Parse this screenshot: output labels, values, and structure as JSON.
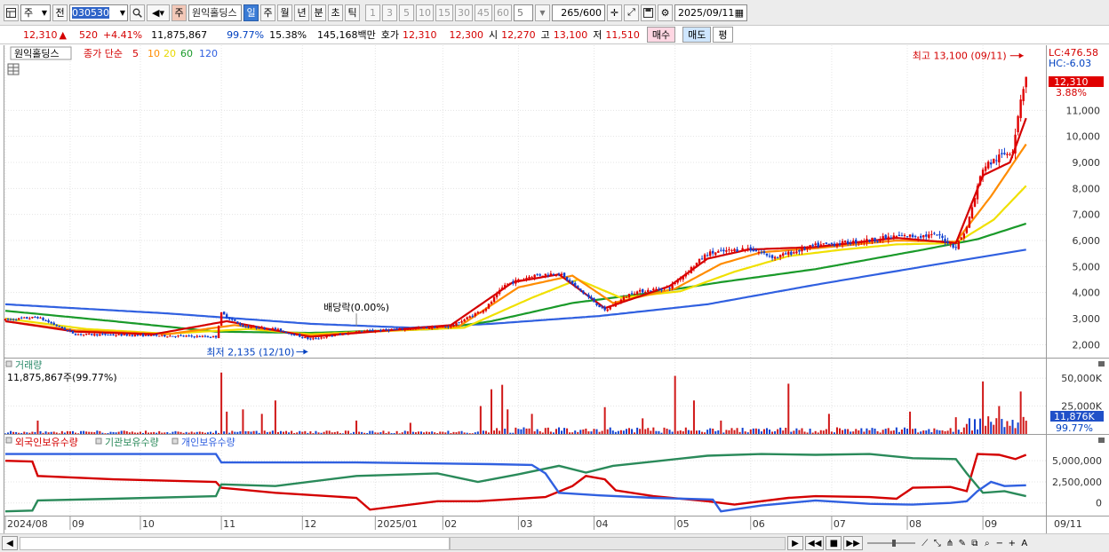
{
  "toolbar": {
    "icon_left": "chart-layout-icon",
    "market_combo": "주",
    "prev_label": "전",
    "stock_code": "030530",
    "stock_name": "원익홀딩스",
    "stock_tag": "주",
    "periods": [
      "일",
      "주",
      "월",
      "년",
      "분",
      "초",
      "틱"
    ],
    "selected_period": "일",
    "intervals": [
      "1",
      "3",
      "5",
      "10",
      "15",
      "30",
      "45",
      "60"
    ],
    "interval_value": "5",
    "count_current": "265",
    "count_total": "/600",
    "date": "2025/09/11"
  },
  "quote": {
    "price": "12,310",
    "change_arrow": "▲",
    "change": "520",
    "change_pct": "+4.41%",
    "volume": "11,875,867",
    "volume_ratio": "99.77%",
    "turnover": "15.38%",
    "amount": "145,168백만",
    "ask_label": "호가",
    "ask": "12,310",
    "bid": "12,300",
    "open_label": "시",
    "open": "12,270",
    "high_label": "고",
    "high": "13,100",
    "low_label": "저",
    "low": "11,510",
    "buy_label": "매수",
    "sell_label": "매도",
    "eval_label": "평"
  },
  "chart_data": [
    {
      "type": "candlestick",
      "title": "원익홀딩스",
      "legend": [
        "종가 단순",
        "5",
        "10",
        "20",
        "60",
        "120"
      ],
      "legend_colors": [
        "#d40000",
        "#d40000",
        "#ff8c00",
        "#e8d800",
        "#1a9a2a",
        "#3060e0"
      ],
      "y_ticks": [
        2000,
        3000,
        4000,
        5000,
        6000,
        7000,
        8000,
        9000,
        10000,
        11000
      ],
      "y_tick_labels": [
        "2,000",
        "3,000",
        "4,000",
        "5,000",
        "6,000",
        "7,000",
        "8,000",
        "9,000",
        "10,000",
        "11,000"
      ],
      "ylim": [
        1500,
        13500
      ],
      "x_labels": [
        "2024/08",
        "09",
        "10",
        "11",
        "12",
        "2025/01",
        "02",
        "03",
        "04",
        "05",
        "06",
        "07",
        "08",
        "09"
      ],
      "x_label_positions": [
        0,
        24,
        50,
        80,
        110,
        137,
        162,
        190,
        218,
        248,
        276,
        306,
        334,
        362
      ],
      "n_days": 385,
      "price_path": [
        [
          0,
          2950
        ],
        [
          12,
          3050
        ],
        [
          26,
          2400
        ],
        [
          55,
          2350
        ],
        [
          78,
          2300
        ],
        [
          80,
          3200
        ],
        [
          88,
          2700
        ],
        [
          100,
          2600
        ],
        [
          113,
          2200
        ],
        [
          130,
          2500
        ],
        [
          140,
          2550
        ],
        [
          165,
          2700
        ],
        [
          178,
          3400
        ],
        [
          185,
          4300
        ],
        [
          195,
          4650
        ],
        [
          205,
          4750
        ],
        [
          215,
          3900
        ],
        [
          222,
          3300
        ],
        [
          232,
          4000
        ],
        [
          246,
          4200
        ],
        [
          260,
          5500
        ],
        [
          275,
          5700
        ],
        [
          285,
          5350
        ],
        [
          300,
          5800
        ],
        [
          315,
          5950
        ],
        [
          330,
          6150
        ],
        [
          345,
          6200
        ],
        [
          352,
          5750
        ],
        [
          356,
          6500
        ],
        [
          362,
          8800
        ],
        [
          368,
          9200
        ],
        [
          373,
          9500
        ],
        [
          376,
          11500
        ],
        [
          378,
          12310
        ]
      ],
      "ma_paths": {
        "5": [
          [
            0,
            2900
          ],
          [
            26,
            2500
          ],
          [
            55,
            2400
          ],
          [
            82,
            2900
          ],
          [
            113,
            2300
          ],
          [
            165,
            2750
          ],
          [
            188,
            4400
          ],
          [
            205,
            4700
          ],
          [
            222,
            3400
          ],
          [
            246,
            4250
          ],
          [
            260,
            5300
          ],
          [
            275,
            5650
          ],
          [
            300,
            5750
          ],
          [
            330,
            6100
          ],
          [
            352,
            5900
          ],
          [
            362,
            8500
          ],
          [
            372,
            9000
          ],
          [
            378,
            10700
          ]
        ],
        "10": [
          [
            0,
            2900
          ],
          [
            26,
            2550
          ],
          [
            60,
            2400
          ],
          [
            85,
            2750
          ],
          [
            113,
            2350
          ],
          [
            168,
            2700
          ],
          [
            190,
            4200
          ],
          [
            210,
            4650
          ],
          [
            225,
            3600
          ],
          [
            248,
            4150
          ],
          [
            265,
            5100
          ],
          [
            280,
            5550
          ],
          [
            300,
            5700
          ],
          [
            330,
            6000
          ],
          [
            352,
            5950
          ],
          [
            365,
            7700
          ],
          [
            378,
            9700
          ]
        ],
        "20": [
          [
            0,
            3000
          ],
          [
            30,
            2600
          ],
          [
            60,
            2420
          ],
          [
            90,
            2600
          ],
          [
            113,
            2400
          ],
          [
            170,
            2650
          ],
          [
            195,
            3800
          ],
          [
            212,
            4500
          ],
          [
            228,
            3800
          ],
          [
            250,
            4050
          ],
          [
            270,
            4800
          ],
          [
            290,
            5400
          ],
          [
            310,
            5650
          ],
          [
            330,
            5850
          ],
          [
            352,
            5900
          ],
          [
            366,
            6800
          ],
          [
            378,
            8100
          ]
        ],
        "60": [
          [
            0,
            3300
          ],
          [
            40,
            2900
          ],
          [
            78,
            2500
          ],
          [
            113,
            2450
          ],
          [
            160,
            2600
          ],
          [
            180,
            2900
          ],
          [
            210,
            3600
          ],
          [
            240,
            4000
          ],
          [
            265,
            4400
          ],
          [
            300,
            4900
          ],
          [
            340,
            5650
          ],
          [
            360,
            6050
          ],
          [
            378,
            6650
          ]
        ],
        "120": [
          [
            0,
            3550
          ],
          [
            60,
            3200
          ],
          [
            113,
            2800
          ],
          [
            150,
            2650
          ],
          [
            180,
            2800
          ],
          [
            220,
            3100
          ],
          [
            260,
            3550
          ],
          [
            300,
            4300
          ],
          [
            340,
            5000
          ],
          [
            378,
            5650
          ]
        ]
      },
      "annotations": {
        "high": {
          "text": "최고 13,100 (09/11)",
          "day": 378,
          "value": 13100
        },
        "low": {
          "text": "최저 2,135 (12/10)",
          "day": 113,
          "value": 2135
        },
        "dividend": {
          "text": "배당락(0.00%)",
          "day": 130
        }
      },
      "right_labels": {
        "lc": "LC:476.58",
        "hc": "HC:-6.03",
        "price": "12,310",
        "pct": "3.88%"
      }
    },
    {
      "type": "bar",
      "title": "거래량",
      "subtitle": "11,875,867주(99.77%)",
      "y_ticks": [
        25000000,
        50000000
      ],
      "y_tick_labels": [
        "25,000K",
        "50,000K"
      ],
      "ylim": [
        0,
        58000000
      ],
      "current_label": "11,876K",
      "current_pct": "99.77%",
      "spikes": [
        [
          12,
          12000000
        ],
        [
          80,
          55000000
        ],
        [
          82,
          20000000
        ],
        [
          88,
          22000000
        ],
        [
          95,
          18000000
        ],
        [
          100,
          30000000
        ],
        [
          130,
          12000000
        ],
        [
          150,
          10000000
        ],
        [
          176,
          25000000
        ],
        [
          180,
          40000000
        ],
        [
          184,
          44000000
        ],
        [
          186,
          22000000
        ],
        [
          195,
          18000000
        ],
        [
          222,
          24000000
        ],
        [
          236,
          14000000
        ],
        [
          248,
          52000000
        ],
        [
          255,
          30000000
        ],
        [
          265,
          12000000
        ],
        [
          290,
          45000000
        ],
        [
          305,
          18000000
        ],
        [
          335,
          20000000
        ],
        [
          352,
          15000000
        ],
        [
          362,
          47000000
        ],
        [
          368,
          25000000
        ],
        [
          376,
          38000000
        ],
        [
          378,
          11876000
        ]
      ]
    },
    {
      "type": "line",
      "series_names": [
        "외국인보유수량",
        "기관보유수량",
        "개인보유수량"
      ],
      "series_colors": [
        "#d40000",
        "#2a8a5a",
        "#3060e0"
      ],
      "y_ticks": [
        0,
        2500000,
        5000000
      ],
      "y_tick_labels": [
        "0",
        "2,500,000",
        "5,000,000"
      ],
      "ylim": [
        -1500000,
        6700000
      ],
      "series": [
        {
          "name": "외국인보유수량",
          "points": [
            [
              0,
              5000000
            ],
            [
              10,
              4900000
            ],
            [
              12,
              3200000
            ],
            [
              40,
              2800000
            ],
            [
              78,
              2500000
            ],
            [
              80,
              1800000
            ],
            [
              100,
              1200000
            ],
            [
              130,
              600000
            ],
            [
              135,
              -800000
            ],
            [
              160,
              200000
            ],
            [
              175,
              200000
            ],
            [
              200,
              700000
            ],
            [
              210,
              2000000
            ],
            [
              215,
              3200000
            ],
            [
              222,
              2800000
            ],
            [
              226,
              1500000
            ],
            [
              240,
              800000
            ],
            [
              260,
              200000
            ],
            [
              270,
              -200000
            ],
            [
              290,
              600000
            ],
            [
              300,
              800000
            ],
            [
              320,
              700000
            ],
            [
              330,
              500000
            ],
            [
              336,
              1800000
            ],
            [
              350,
              1900000
            ],
            [
              356,
              1400000
            ],
            [
              360,
              5800000
            ],
            [
              368,
              5700000
            ],
            [
              374,
              5200000
            ],
            [
              378,
              5700000
            ]
          ]
        },
        {
          "name": "기관보유수량",
          "points": [
            [
              0,
              -1000000
            ],
            [
              10,
              -900000
            ],
            [
              12,
              300000
            ],
            [
              40,
              500000
            ],
            [
              78,
              800000
            ],
            [
              80,
              2200000
            ],
            [
              100,
              2000000
            ],
            [
              130,
              3200000
            ],
            [
              160,
              3500000
            ],
            [
              175,
              2500000
            ],
            [
              190,
              3400000
            ],
            [
              205,
              4400000
            ],
            [
              215,
              3600000
            ],
            [
              225,
              4400000
            ],
            [
              240,
              4900000
            ],
            [
              260,
              5600000
            ],
            [
              280,
              5800000
            ],
            [
              300,
              5700000
            ],
            [
              320,
              5800000
            ],
            [
              336,
              5300000
            ],
            [
              352,
              5200000
            ],
            [
              356,
              3500000
            ],
            [
              362,
              1200000
            ],
            [
              370,
              1400000
            ],
            [
              378,
              800000
            ]
          ]
        },
        {
          "name": "개인보유수량",
          "points": [
            [
              0,
              5800000
            ],
            [
              78,
              5800000
            ],
            [
              80,
              4800000
            ],
            [
              130,
              4800000
            ],
            [
              180,
              4600000
            ],
            [
              195,
              4500000
            ],
            [
              200,
              3500000
            ],
            [
              205,
              1200000
            ],
            [
              220,
              900000
            ],
            [
              240,
              600000
            ],
            [
              262,
              400000
            ],
            [
              265,
              -1000000
            ],
            [
              280,
              -300000
            ],
            [
              300,
              300000
            ],
            [
              320,
              -100000
            ],
            [
              336,
              -200000
            ],
            [
              350,
              0
            ],
            [
              356,
              200000
            ],
            [
              360,
              1400000
            ],
            [
              365,
              2500000
            ],
            [
              370,
              2000000
            ],
            [
              378,
              2100000
            ]
          ]
        }
      ]
    }
  ],
  "scroll": {
    "zoom_label": "A",
    "minus": "−",
    "plus": "+"
  }
}
